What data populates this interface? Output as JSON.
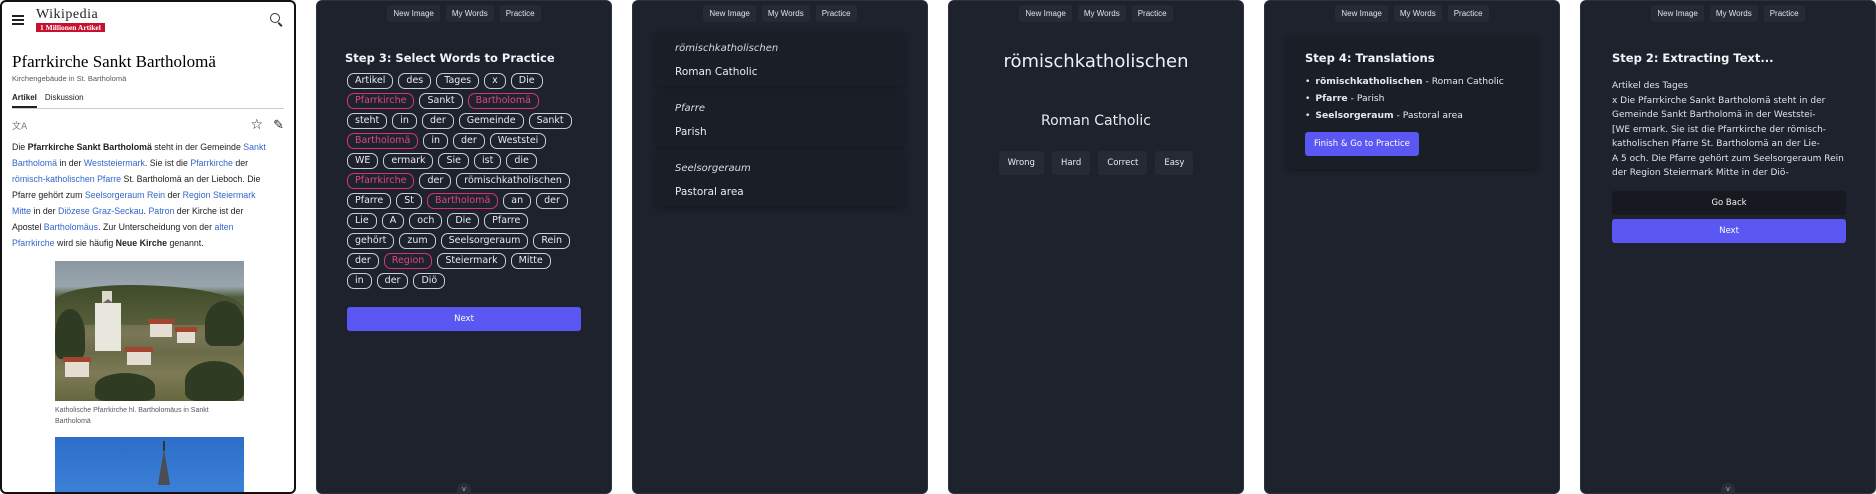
{
  "nav": {
    "new_image": "New Image",
    "my_words": "My Words",
    "practice": "Practice"
  },
  "wiki": {
    "logo_text": "Wikipedia",
    "logo_badge": "1 Millionen Artikel",
    "title": "Pfarrkirche Sankt Bartholomä",
    "subtitle": "Kirchengebäude in St. Bartholomä",
    "tab_article": "Artikel",
    "tab_discussion": "Diskussion",
    "body": [
      [
        [
          "t",
          "Die "
        ],
        [
          "b",
          "Pfarrkirche Sankt Bartholomä"
        ],
        [
          "t",
          " steht in der Gemeinde "
        ],
        [
          "l",
          "Sankt"
        ]
      ],
      [
        [
          "l",
          "Bartholomä"
        ],
        [
          "t",
          " in der "
        ],
        [
          "l",
          "Weststeiermark"
        ],
        [
          "t",
          ". Sie ist die "
        ],
        [
          "l",
          "Pfarrkirche"
        ],
        [
          "t",
          " der"
        ]
      ],
      [
        [
          "l",
          "römisch-katholischen Pfarre"
        ],
        [
          "t",
          " St. Bartholomä an der Lieboch. Die"
        ]
      ],
      [
        [
          "t",
          "Pfarre gehört zum "
        ],
        [
          "l",
          "Seelsorgeraum Rein"
        ],
        [
          "t",
          " der "
        ],
        [
          "l",
          "Region Steiermark"
        ]
      ],
      [
        [
          "l",
          "Mitte"
        ],
        [
          "t",
          " in der "
        ],
        [
          "l",
          "Diözese Graz-Seckau"
        ],
        [
          "t",
          ". "
        ],
        [
          "l",
          "Patron"
        ],
        [
          "t",
          " der Kirche ist der"
        ]
      ],
      [
        [
          "t",
          "Apostel "
        ],
        [
          "l",
          "Bartholomäus"
        ],
        [
          "t",
          ". Zur Unterscheidung von der "
        ],
        [
          "l",
          "alten"
        ]
      ],
      [
        [
          "l",
          "Pfarrkirche"
        ],
        [
          "t",
          " wird sie häufig "
        ],
        [
          "b",
          "Neue Kirche"
        ],
        [
          "t",
          " genannt."
        ]
      ]
    ],
    "caption_1": "Katholische Pfarrkirche hl. Bartholomäus in Sankt",
    "caption_2": "Bartholomä"
  },
  "select": {
    "heading": "Step 3: Select Words to Practice",
    "chips": [
      {
        "w": "Artikel",
        "s": false
      },
      {
        "w": "des",
        "s": false
      },
      {
        "w": "Tages",
        "s": false
      },
      {
        "w": "x",
        "s": false
      },
      {
        "w": "Die",
        "s": false
      },
      {
        "w": "Pfarrkirche",
        "s": true
      },
      {
        "w": "Sankt",
        "s": false
      },
      {
        "w": "Bartholomä",
        "s": true
      },
      {
        "w": "steht",
        "s": false
      },
      {
        "w": "in",
        "s": false
      },
      {
        "w": "der",
        "s": false
      },
      {
        "w": "Gemeinde",
        "s": false
      },
      {
        "w": "Sankt",
        "s": false
      },
      {
        "w": "Bartholomä",
        "s": true
      },
      {
        "w": "in",
        "s": false
      },
      {
        "w": "der",
        "s": false
      },
      {
        "w": "Weststei",
        "s": false
      },
      {
        "w": "WE",
        "s": false
      },
      {
        "w": "ermark",
        "s": false
      },
      {
        "w": "Sie",
        "s": false
      },
      {
        "w": "ist",
        "s": false
      },
      {
        "w": "die",
        "s": false
      },
      {
        "w": "Pfarrkirche",
        "s": true
      },
      {
        "w": "der",
        "s": false
      },
      {
        "w": "römischkatholischen",
        "s": false
      },
      {
        "w": "Pfarre",
        "s": false
      },
      {
        "w": "St",
        "s": false
      },
      {
        "w": "Bartholomä",
        "s": true
      },
      {
        "w": "an",
        "s": false
      },
      {
        "w": "der",
        "s": false
      },
      {
        "w": "Lie",
        "s": false
      },
      {
        "w": "A",
        "s": false
      },
      {
        "w": "och",
        "s": false
      },
      {
        "w": "Die",
        "s": false
      },
      {
        "w": "Pfarre",
        "s": false
      },
      {
        "w": "gehört",
        "s": false
      },
      {
        "w": "zum",
        "s": false
      },
      {
        "w": "Seelsorgeraum",
        "s": false
      },
      {
        "w": "Rein",
        "s": false
      },
      {
        "w": "der",
        "s": false
      },
      {
        "w": "Region",
        "s": true
      },
      {
        "w": "Steiermark",
        "s": false
      },
      {
        "w": "Mitte",
        "s": false
      },
      {
        "w": "in",
        "s": false
      },
      {
        "w": "der",
        "s": false
      },
      {
        "w": "Diö",
        "s": false
      }
    ],
    "next_label": "Next"
  },
  "my_words": [
    {
      "de": "römischkatholischen",
      "en": "Roman Catholic"
    },
    {
      "de": "Pfarre",
      "en": "Parish"
    },
    {
      "de": "Seelsorgeraum",
      "en": "Pastoral area"
    }
  ],
  "flashcard": {
    "word": "römischkatholischen",
    "translation": "Roman Catholic",
    "buttons": [
      "Wrong",
      "Hard",
      "Correct",
      "Easy"
    ]
  },
  "translations": {
    "heading": "Step 4: Translations",
    "items": [
      {
        "de": "römischkatholischen",
        "en": "Roman Catholic"
      },
      {
        "de": "Pfarre",
        "en": "Parish"
      },
      {
        "de": "Seelsorgeraum",
        "en": "Pastoral area"
      }
    ],
    "finish_label": "Finish & Go to Practice"
  },
  "extract": {
    "heading": "Step 2: Extracting Text...",
    "lines": [
      "Artikel des Tages",
      "x Die Pfarrkirche Sankt Bartholomä steht in der",
      "Gemeinde Sankt Bartholomä in der Weststei-",
      "[WE ermark. Sie ist die Pfarrkirche der römisch-",
      "katholischen Pfarre St. Bartholomä an der Lie-",
      "A 5 och. Die Pfarre gehört zum Seelsorgeraum Rein",
      "der Region Steiermark Mitte in der Diö-"
    ],
    "back_label": "Go Back",
    "next_label": "Next"
  },
  "colors": {
    "accent": "#5b57f2",
    "selected": "#d6337c",
    "panel_bg": "#1e222c",
    "wiki_link": "#3366cc"
  }
}
